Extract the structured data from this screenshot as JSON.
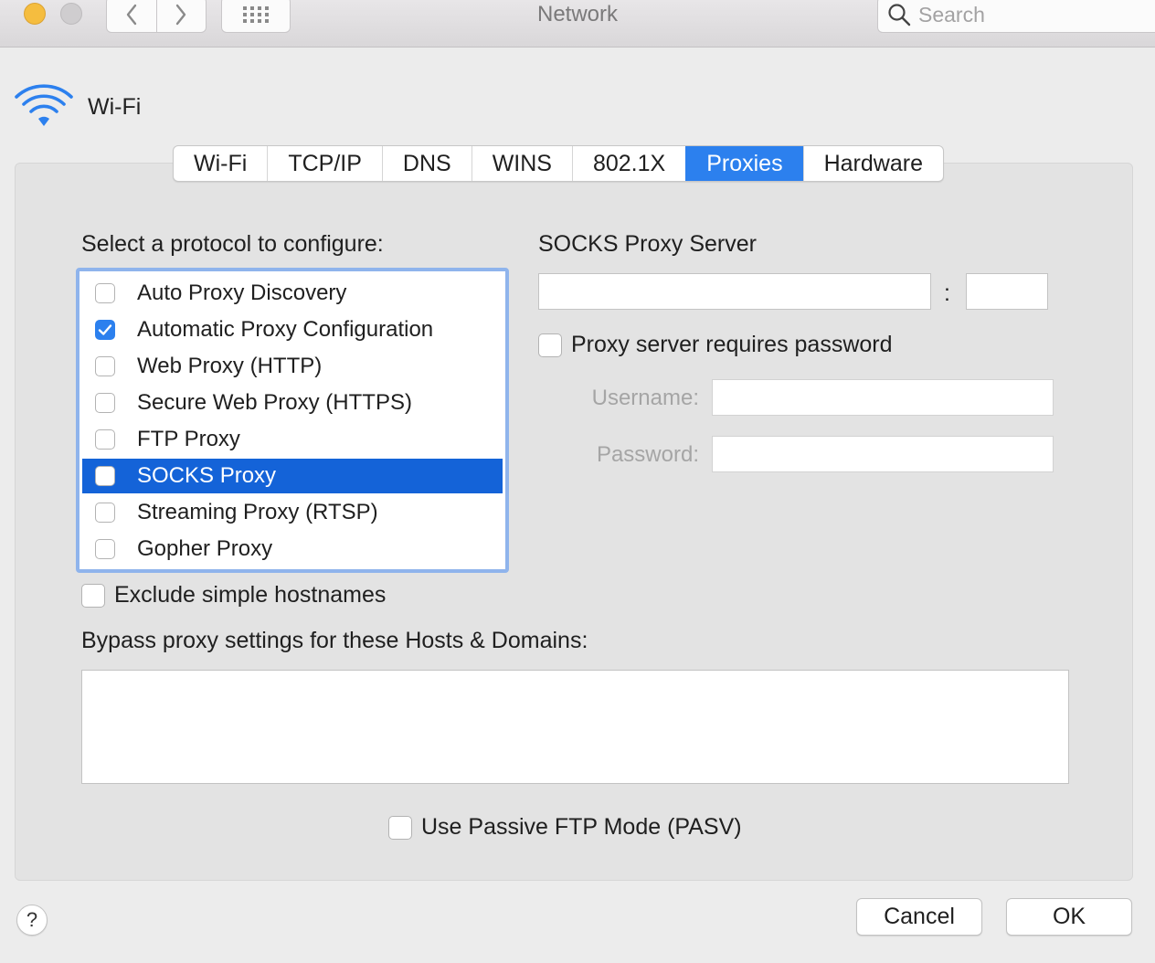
{
  "window": {
    "title": "Network",
    "search_placeholder": "Search"
  },
  "header": {
    "interface_name": "Wi-Fi"
  },
  "tabs": [
    {
      "label": "Wi-Fi"
    },
    {
      "label": "TCP/IP"
    },
    {
      "label": "DNS"
    },
    {
      "label": "WINS"
    },
    {
      "label": "802.1X"
    },
    {
      "label": "Proxies",
      "active": true
    },
    {
      "label": "Hardware"
    }
  ],
  "protocols": {
    "heading": "Select a protocol to configure:",
    "items": [
      {
        "label": "Auto Proxy Discovery",
        "checked": false
      },
      {
        "label": "Automatic Proxy Configuration",
        "checked": true
      },
      {
        "label": "Web Proxy (HTTP)",
        "checked": false
      },
      {
        "label": "Secure Web Proxy (HTTPS)",
        "checked": false
      },
      {
        "label": "FTP Proxy",
        "checked": false
      },
      {
        "label": "SOCKS Proxy",
        "checked": false,
        "selected": true
      },
      {
        "label": "Streaming Proxy (RTSP)",
        "checked": false
      },
      {
        "label": "Gopher Proxy",
        "checked": false
      }
    ]
  },
  "server": {
    "heading": "SOCKS Proxy Server",
    "host_value": "",
    "separator": ":",
    "port_value": "",
    "requires_password_label": "Proxy server requires password",
    "requires_password_checked": false,
    "username_label": "Username:",
    "username_value": "",
    "password_label": "Password:",
    "password_value": ""
  },
  "options": {
    "exclude_simple_label": "Exclude simple hostnames",
    "exclude_simple_checked": false,
    "bypass_heading": "Bypass proxy settings for these Hosts & Domains:",
    "bypass_value": "",
    "passive_ftp_label": "Use Passive FTP Mode (PASV)",
    "passive_ftp_checked": false
  },
  "footer": {
    "help_label": "?",
    "cancel_label": "Cancel",
    "ok_label": "OK"
  },
  "colors": {
    "accent": "#2c80ee",
    "selection": "#1463d8",
    "wifi_icon": "#2c80ee"
  },
  "icons": [
    "back-chevron-icon",
    "forward-chevron-icon",
    "grid-icon",
    "search-icon",
    "wifi-icon",
    "checkmark-icon"
  ]
}
